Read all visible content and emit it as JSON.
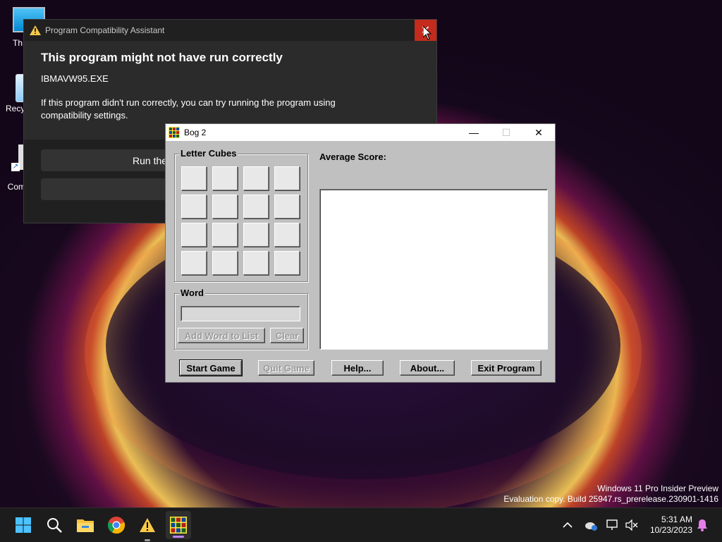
{
  "desktop": {
    "icons": [
      {
        "label": "Th",
        "name": "this-pc"
      },
      {
        "label": "Recy",
        "name": "recycle-bin"
      },
      {
        "label": "To Comm",
        "name": "shortcut"
      }
    ],
    "watermark_line1": "Windows 11 Pro Insider Preview",
    "watermark_line2": "Evaluation copy. Build 25947.rs_prerelease.230901-1416"
  },
  "pca": {
    "title": "Program Compatibility Assistant",
    "heading": "This program might not have run correctly",
    "exe": "IBMAVW95.EXE",
    "message": "If this program didn't run correctly, you can try running the program using compatibility settings.",
    "button1": "Run the",
    "button2": "",
    "close_glyph": "✕"
  },
  "bog": {
    "title": "Bog 2",
    "letter_cubes_label": "Letter Cubes",
    "average_score_label": "Average Score:",
    "word_label": "Word",
    "add_word_button": "Add Word to List",
    "clear_button": "Clear",
    "start_button": "Start Game",
    "quit_button": "Quit Game",
    "help_button": "Help...",
    "about_button": "About...",
    "exit_button": "Exit Program",
    "minimize": "—",
    "maximize": "☐",
    "close": "✕"
  },
  "taskbar": {
    "icons": [
      "windows-start-icon",
      "search-icon",
      "file-explorer-icon",
      "chrome-icon",
      "warning-icon",
      "bog-app-icon"
    ],
    "time": "5:31 AM",
    "date": "10/23/2023"
  }
}
